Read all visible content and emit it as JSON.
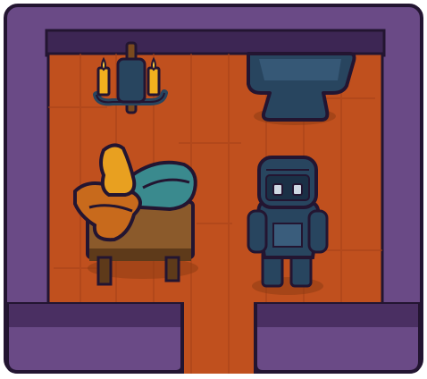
{
  "scene": {
    "type": "top-down room tile",
    "description_name": "armory-room",
    "objects": [
      {
        "name": "wall-candelabra-icon",
        "kind": "candelabra",
        "candles": 2
      },
      {
        "name": "anvil-icon",
        "kind": "anvil"
      },
      {
        "name": "table-with-cloth-bundles-icon",
        "kind": "table"
      },
      {
        "name": "knight-armor-stand-icon",
        "kind": "armor"
      }
    ],
    "exits": [
      "bottom"
    ]
  },
  "colors": {
    "wall_outer": "#4a2f62",
    "wall_main": "#6a4a86",
    "wall_inner_shadow": "#3d2654",
    "outline": "#231531",
    "floor": "#c0501e",
    "floor_plank_line": "#a8431a",
    "metal_dark": "#28455f",
    "metal_mid": "#3a5d7c",
    "candle": "#f2b01e",
    "flame": "#ffd23f",
    "wood": "#8b5a2b",
    "wood_dark": "#5e3a1a",
    "cloth_orange": "#c86a1c",
    "cloth_yellow": "#e8a020",
    "cloth_teal": "#3a8a8e"
  }
}
